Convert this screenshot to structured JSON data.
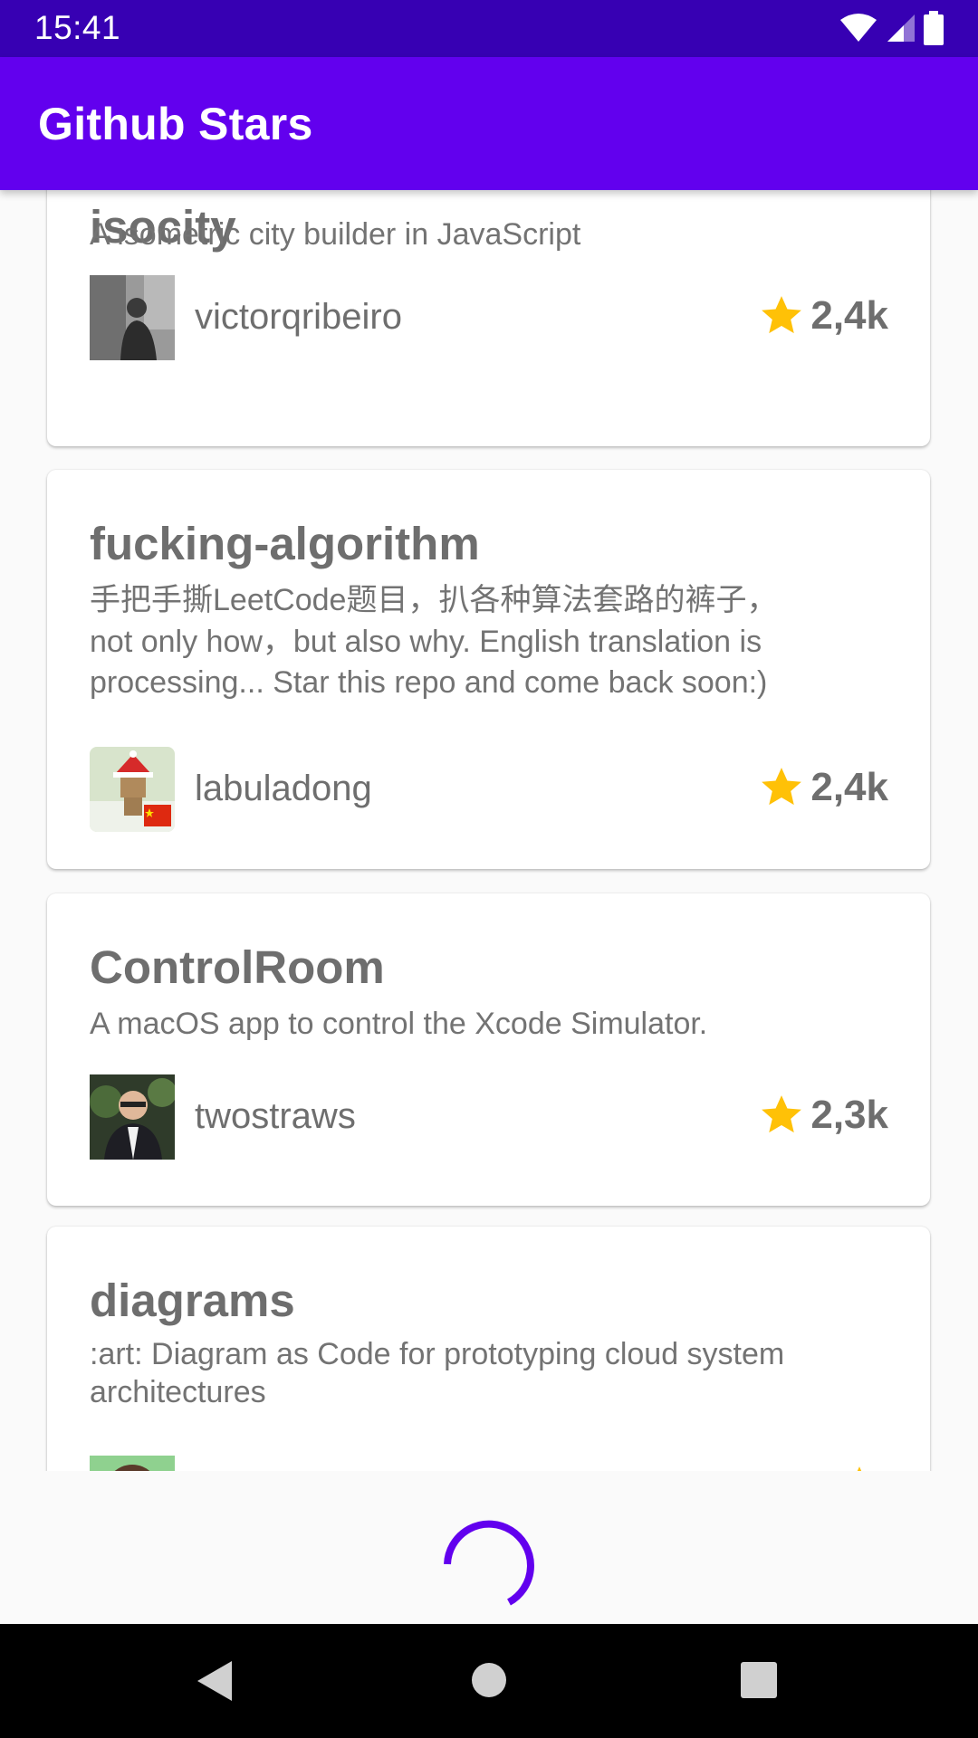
{
  "status_bar": {
    "time": "15:41"
  },
  "app_bar": {
    "title": "Github Stars"
  },
  "repos": [
    {
      "name": "isocity",
      "description": "A isometric city builder in JavaScript",
      "owner": "victorqribeiro",
      "stars": "2,4k"
    },
    {
      "name": "fucking-algorithm",
      "description_line1": "手把手撕LeetCode题目，扒各种算法套路的裤子，",
      "description_line2": "not only how，but also why. English translation is processing... Star this repo and come back soon:)",
      "owner": "labuladong",
      "stars": "2,4k"
    },
    {
      "name": "ControlRoom",
      "description": "A macOS app to control the Xcode Simulator.",
      "owner": "twostraws",
      "stars": "2,3k"
    },
    {
      "name": "diagrams",
      "description": ":art: Diagram as Code for prototyping cloud system architectures"
    }
  ],
  "colors": {
    "status_bar": "#3700b3",
    "app_bar": "#6200ee",
    "star": "#ffc107",
    "loader": "#6200ee"
  },
  "icons": {
    "star": "star-icon",
    "wifi": "wifi-icon",
    "signal": "cell-signal-icon",
    "battery": "battery-icon",
    "back": "back-icon",
    "home": "home-icon",
    "recents": "recents-icon"
  }
}
